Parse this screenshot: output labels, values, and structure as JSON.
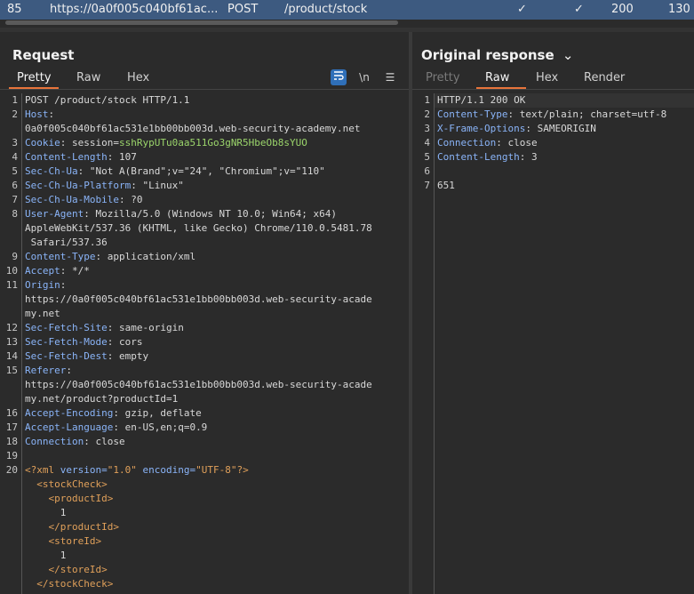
{
  "history_row": {
    "number": "85",
    "host": "https://0a0f005c040bf61ac...",
    "method": "POST",
    "url": "/product/stock",
    "params_check": "✓",
    "edited_check": "✓",
    "status": "200",
    "length": "130"
  },
  "request": {
    "title": "Request",
    "tabs": [
      "Pretty",
      "Raw",
      "Hex"
    ],
    "newline_label": "\\n",
    "line_numbers": [
      "1",
      "2",
      "",
      "3",
      "4",
      "5",
      "6",
      "7",
      "8",
      "",
      "",
      "9",
      "10",
      "11",
      "",
      "",
      "12",
      "13",
      "14",
      "15",
      "",
      "",
      "16",
      "17",
      "18",
      "19",
      "20",
      "",
      "",
      "",
      "",
      "",
      "",
      "",
      "",
      ""
    ],
    "lines": [
      {
        "t": "plain",
        "text": "POST /product/stock HTTP/1.1"
      },
      {
        "t": "header",
        "key": "Host",
        "sep": ":",
        "val": ""
      },
      {
        "t": "plain",
        "text": "0a0f005c040bf61ac531e1bb00bb003d.web-security-academy.net"
      },
      {
        "t": "cookie",
        "key": "Cookie",
        "sep": ": session=",
        "val": "sshRypUTu0aa511Go3gNR5HbeOb8sYUO"
      },
      {
        "t": "header",
        "key": "Content-Length",
        "sep": ": ",
        "val": "107"
      },
      {
        "t": "header",
        "key": "Sec-Ch-Ua",
        "sep": ": ",
        "val": "\"Not A(Brand\";v=\"24\", \"Chromium\";v=\"110\""
      },
      {
        "t": "header",
        "key": "Sec-Ch-Ua-Platform",
        "sep": ": ",
        "val": "\"Linux\""
      },
      {
        "t": "header",
        "key": "Sec-Ch-Ua-Mobile",
        "sep": ": ",
        "val": "?0"
      },
      {
        "t": "header",
        "key": "User-Agent",
        "sep": ": ",
        "val": "Mozilla/5.0 (Windows NT 10.0; Win64; x64)"
      },
      {
        "t": "plain",
        "text": "AppleWebKit/537.36 (KHTML, like Gecko) Chrome/110.0.5481.78"
      },
      {
        "t": "plain",
        "text": " Safari/537.36"
      },
      {
        "t": "header",
        "key": "Content-Type",
        "sep": ": ",
        "val": "application/xml"
      },
      {
        "t": "header",
        "key": "Accept",
        "sep": ": ",
        "val": "*/*"
      },
      {
        "t": "header",
        "key": "Origin",
        "sep": ":",
        "val": ""
      },
      {
        "t": "plain",
        "text": "https://0a0f005c040bf61ac531e1bb00bb003d.web-security-acade"
      },
      {
        "t": "plain",
        "text": "my.net"
      },
      {
        "t": "header",
        "key": "Sec-Fetch-Site",
        "sep": ": ",
        "val": "same-origin"
      },
      {
        "t": "header",
        "key": "Sec-Fetch-Mode",
        "sep": ": ",
        "val": "cors"
      },
      {
        "t": "header",
        "key": "Sec-Fetch-Dest",
        "sep": ": ",
        "val": "empty"
      },
      {
        "t": "header",
        "key": "Referer",
        "sep": ":",
        "val": ""
      },
      {
        "t": "plain",
        "text": "https://0a0f005c040bf61ac531e1bb00bb003d.web-security-acade"
      },
      {
        "t": "plain",
        "text": "my.net/product?productId=1"
      },
      {
        "t": "header",
        "key": "Accept-Encoding",
        "sep": ": ",
        "val": "gzip, deflate"
      },
      {
        "t": "header",
        "key": "Accept-Language",
        "sep": ": ",
        "val": "en-US,en;q=0.9"
      },
      {
        "t": "header",
        "key": "Connection",
        "sep": ": ",
        "val": "close"
      },
      {
        "t": "plain",
        "text": ""
      },
      {
        "t": "xmldecl",
        "a": "<?xml ",
        "b": "version=",
        "c": "\"1.0\"",
        "d": " encoding=",
        "e": "\"UTF-8\"",
        "f": "?>"
      },
      {
        "t": "xml",
        "text": "  <stockCheck>"
      },
      {
        "t": "xml",
        "text": "    <productId>"
      },
      {
        "t": "plain",
        "text": "      1"
      },
      {
        "t": "xml",
        "text": "    </productId>"
      },
      {
        "t": "xml",
        "text": "    <storeId>"
      },
      {
        "t": "plain",
        "text": "      1"
      },
      {
        "t": "xml",
        "text": "    </storeId>"
      },
      {
        "t": "xml",
        "text": "  </stockCheck>"
      }
    ]
  },
  "response": {
    "title": "Original response",
    "tabs": [
      "Pretty",
      "Raw",
      "Hex",
      "Render"
    ],
    "line_numbers": [
      "1",
      "2",
      "3",
      "4",
      "5",
      "6",
      "7"
    ],
    "lines": [
      {
        "t": "plain",
        "text": "HTTP/1.1 200 OK"
      },
      {
        "t": "header",
        "key": "Content-Type",
        "sep": ": ",
        "val": "text/plain; charset=utf-8"
      },
      {
        "t": "header",
        "key": "X-Frame-Options",
        "sep": ": ",
        "val": "SAMEORIGIN"
      },
      {
        "t": "header",
        "key": "Connection",
        "sep": ": ",
        "val": "close"
      },
      {
        "t": "header",
        "key": "Content-Length",
        "sep": ": ",
        "val": "3"
      },
      {
        "t": "plain",
        "text": ""
      },
      {
        "t": "plain",
        "text": "651"
      }
    ]
  },
  "colors": {
    "accent": "#e8743b",
    "selected_row": "#3d5a80",
    "header_key": "#8ab4f8",
    "cookie_value": "#9bd56b"
  }
}
